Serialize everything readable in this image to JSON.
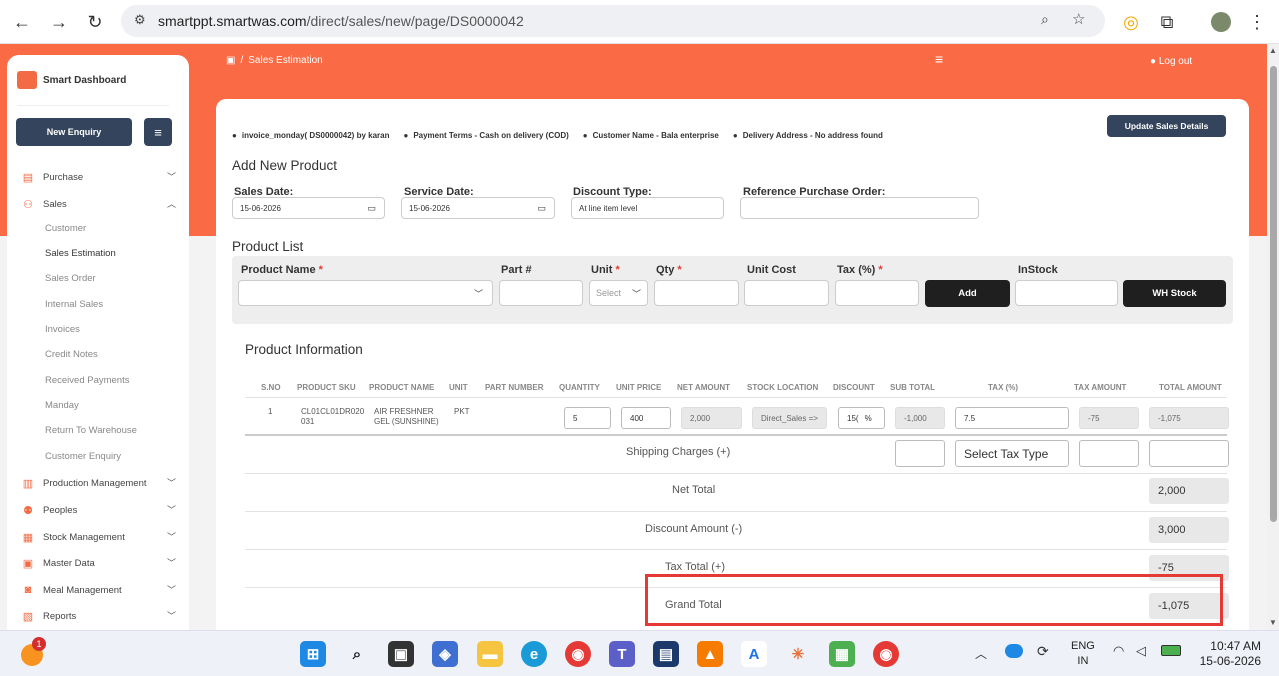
{
  "browser": {
    "url_host": "smartppt.smartwas.com",
    "url_path": "/direct/sales/new/page/DS0000042"
  },
  "sidebar": {
    "brand": "Smart Dashboard",
    "new_enquiry": "New Enquiry",
    "items": [
      {
        "label": "Purchase",
        "icon": "cart-icon",
        "chevron": "down"
      },
      {
        "label": "Sales",
        "icon": "sales-icon",
        "chevron": "up"
      },
      {
        "label": "Production Management",
        "icon": "factory-icon",
        "chevron": "down"
      },
      {
        "label": "Peoples",
        "icon": "people-icon",
        "chevron": "down"
      },
      {
        "label": "Stock Management",
        "icon": "stock-icon",
        "chevron": "down"
      },
      {
        "label": "Master Data",
        "icon": "database-icon",
        "chevron": "down"
      },
      {
        "label": "Meal Management",
        "icon": "meal-icon",
        "chevron": "down"
      },
      {
        "label": "Reports",
        "icon": "reports-icon",
        "chevron": "down"
      }
    ],
    "sales_sub": [
      "Customer",
      "Sales Estimation",
      "Sales Order",
      "Internal Sales",
      "Invoices",
      "Credit Notes",
      "Received Payments",
      "Manday",
      "Return To Warehouse",
      "Customer Enquiry"
    ],
    "active_sub": "Sales Estimation"
  },
  "header": {
    "breadcrumb_sep": "/",
    "breadcrumb": "Sales Estimation",
    "logout": "Log out"
  },
  "info": {
    "invoice": "invoice_monday( DS0000042) by karan",
    "payment": "Payment Terms - Cash on delivery (COD)",
    "customer": "Customer Name - Bala enterprise",
    "address": "Delivery Address - No address found",
    "update_button": "Update Sales Details"
  },
  "form": {
    "title": "Add New Product",
    "sales_date_label": "Sales Date:",
    "sales_date": "15-06-2026",
    "service_date_label": "Service Date:",
    "service_date": "15-06-2026",
    "discount_type_label": "Discount Type:",
    "discount_type": "At line item level",
    "ref_po_label": "Reference Purchase Order:",
    "ref_po": ""
  },
  "product_list": {
    "title": "Product List",
    "product_name_label": "Product Name",
    "part_label": "Part #",
    "unit_label": "Unit",
    "unit_placeholder": "Select",
    "qty_label": "Qty",
    "unit_cost_label": "Unit Cost",
    "tax_label": "Tax (%)",
    "required_mark": "*",
    "add_button": "Add",
    "instock_label": "InStock",
    "wh_stock_button": "WH Stock"
  },
  "product_info": {
    "title": "Product Information",
    "columns": [
      "S.NO",
      "PRODUCT SKU",
      "PRODUCT NAME",
      "UNIT",
      "PART NUMBER",
      "QUANTITY",
      "UNIT PRICE",
      "NET AMOUNT",
      "STOCK LOCATION",
      "DISCOUNT",
      "SUB TOTAL",
      "TAX (%)",
      "TAX AMOUNT",
      "TOTAL AMOUNT"
    ],
    "row": {
      "sno": "1",
      "sku_line1": "CL01CL01DR020",
      "sku_line2": "031",
      "name_line1": "AIR FRESHNER",
      "name_line2": "GEL (SUNSHINE)",
      "unit": "PKT",
      "part": "",
      "quantity": "5",
      "unit_price": "400",
      "net_amount": "2,000",
      "stock_location": "Direct_Sales =>",
      "discount": "15(",
      "discount_unit": "%",
      "sub_total": "-1,000",
      "tax": "7.5",
      "tax_amount": "-75",
      "total_amount": "-1,075"
    },
    "shipping_label": "Shipping Charges (+)",
    "shipping_tax_placeholder": "Select Tax Type",
    "net_total_label": "Net Total",
    "net_total": "2,000",
    "discount_label": "Discount Amount (-)",
    "discount_amount": "3,000",
    "tax_total_label": "Tax Total (+)",
    "tax_total": "-75",
    "grand_total_label": "Grand Total",
    "grand_total": "-1,075"
  },
  "taskbar": {
    "notification_count": "1",
    "lang_line1": "ENG",
    "lang_line2": "IN",
    "time": "10:47 AM",
    "date": "15-06-2026"
  }
}
